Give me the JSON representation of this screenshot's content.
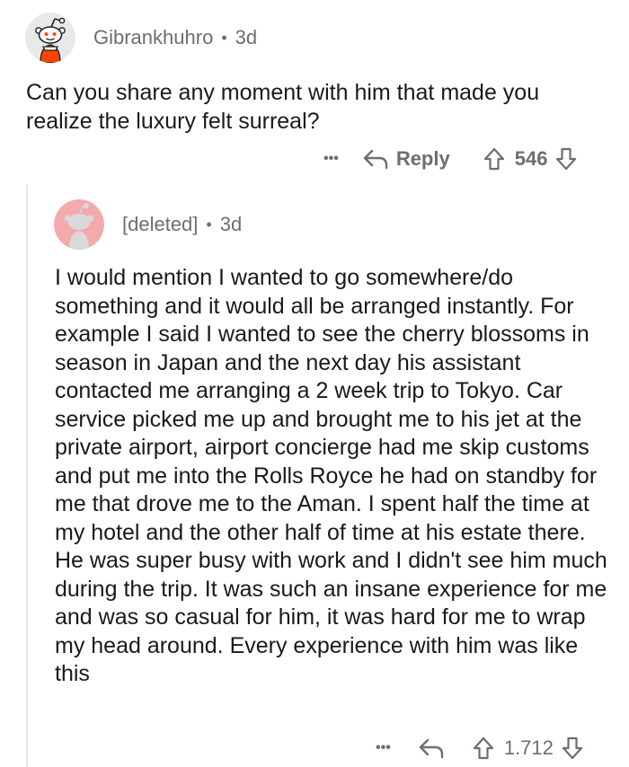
{
  "comments": [
    {
      "author": "Gibrankhuhro",
      "separator": "•",
      "age": "3d",
      "text": "Can you share any moment with him that made you realize the luxury felt surreal?",
      "more": "•••",
      "reply_label": "Reply",
      "score": "546",
      "avatar_icon": "reddit-snoo-avatar",
      "colors": {
        "avatar_bg": "#e9e9e9",
        "avatar_accent": "#ff4500"
      }
    },
    {
      "author": "[deleted]",
      "separator": "•",
      "age": "3d",
      "text": "I would mention I wanted to go somewhere/do something and it would all be arranged instantly. For example I said I wanted to see the cherry blossoms in season in Japan and the next day his assistant contacted me arranging a 2 week trip to Tokyo. Car service picked me up and brought me to his jet at the private airport, airport concierge had me skip customs and put me into the Rolls Royce he had on standby for me that drove me to the Aman. I spent half the time at my hotel and the other half of time at his estate there. He was super busy with work and I didn't see him much during the trip. It was such an insane experience for me and was so casual for him, it was hard for me to wrap my head around. Every experience with him was like this",
      "more": "•••",
      "score": "1.712",
      "avatar_icon": "deleted-user-avatar",
      "colors": {
        "avatar_bg": "#f4a9ad",
        "avatar_fg": "#d9d9d9"
      }
    }
  ]
}
